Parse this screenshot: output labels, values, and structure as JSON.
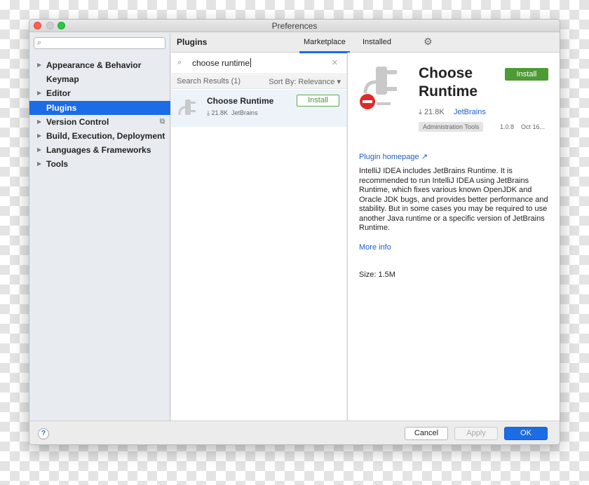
{
  "window": {
    "title": "Preferences"
  },
  "sidebar": {
    "search_placeholder": "",
    "items": [
      {
        "label": "Appearance & Behavior",
        "expandable": true
      },
      {
        "label": "Keymap",
        "expandable": false
      },
      {
        "label": "Editor",
        "expandable": true
      },
      {
        "label": "Plugins",
        "expandable": false,
        "selected": true
      },
      {
        "label": "Version Control",
        "expandable": true
      },
      {
        "label": "Build, Execution, Deployment",
        "expandable": true
      },
      {
        "label": "Languages & Frameworks",
        "expandable": true
      },
      {
        "label": "Tools",
        "expandable": true
      }
    ]
  },
  "plugins": {
    "title": "Plugins",
    "tabs": [
      {
        "label": "Marketplace",
        "active": true
      },
      {
        "label": "Installed",
        "active": false
      }
    ],
    "search_query": "choose runtime",
    "results_label": "Search Results (1)",
    "sort_label": "Sort By: Relevance",
    "results": [
      {
        "name": "Choose Runtime",
        "downloads": "21.8K",
        "vendor": "JetBrains",
        "install_label": "Install"
      }
    ]
  },
  "detail": {
    "name": "Choose Runtime",
    "install_label": "Install",
    "downloads": "21.8K",
    "vendor": "JetBrains",
    "tag": "Administration Tools",
    "version": "1.0.8",
    "date": "Oct 16...",
    "homepage_label": "Plugin homepage",
    "description": "IntelliJ IDEA includes JetBrains Runtime. It is recommended to run IntelliJ IDEA using JetBrains Runtime, which fixes various known OpenJDK and Oracle JDK bugs, and provides better performance and stability. But in some cases you may be required to use another Java runtime or a specific version of JetBrains Runtime.",
    "more_info_label": "More info",
    "size_label": "Size: 1.5M"
  },
  "footer": {
    "help_label": "?",
    "cancel_label": "Cancel",
    "apply_label": "Apply",
    "ok_label": "OK"
  },
  "colors": {
    "accent": "#1b6ce5",
    "install_green": "#4e9a35",
    "link": "#1b5fc6",
    "error_red": "#e02a2a"
  },
  "icons": {
    "search": "magnifier-icon",
    "settings": "gear-icon",
    "clear": "close-icon",
    "plugin": "plug-icon"
  }
}
